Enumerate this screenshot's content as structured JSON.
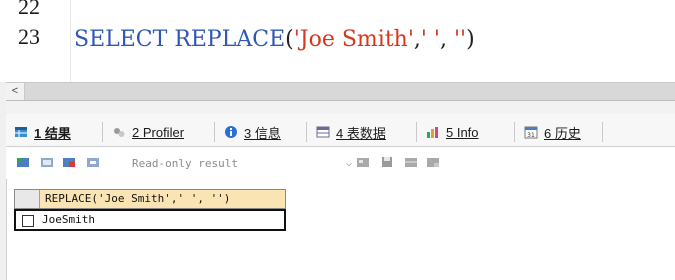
{
  "editor": {
    "line_numbers": [
      "22",
      "23"
    ],
    "sql": {
      "keyword_select": "SELECT",
      "keyword_replace": "REPLACE",
      "open_paren": "(",
      "arg1": "'Joe Smith'",
      "comma1": ",",
      "arg2": "' '",
      "comma2": ",",
      "arg3": "''",
      "close_paren": ")"
    }
  },
  "scrollbar": {
    "left_arrow": "<"
  },
  "tabs": [
    {
      "label": "1 结果",
      "icon": "result-grid-icon",
      "active": true
    },
    {
      "label": "2 Profiler",
      "icon": "profiler-icon"
    },
    {
      "label": "3 信息",
      "icon": "info-icon"
    },
    {
      "label": "4 表数据",
      "icon": "table-data-icon"
    },
    {
      "label": "5 Info",
      "icon": "info-chart-icon"
    },
    {
      "label": "6 历史",
      "icon": "history-icon"
    }
  ],
  "toolbar": {
    "mode_select": "Read-only result"
  },
  "result": {
    "column_header": "REPLACE('Joe Smith',' ', '')",
    "rows": [
      {
        "value": "JoeSmith"
      }
    ]
  },
  "colors": {
    "keyword": "#2e57b8",
    "string": "#d6371c",
    "header_bg": "#fbe4b4"
  }
}
